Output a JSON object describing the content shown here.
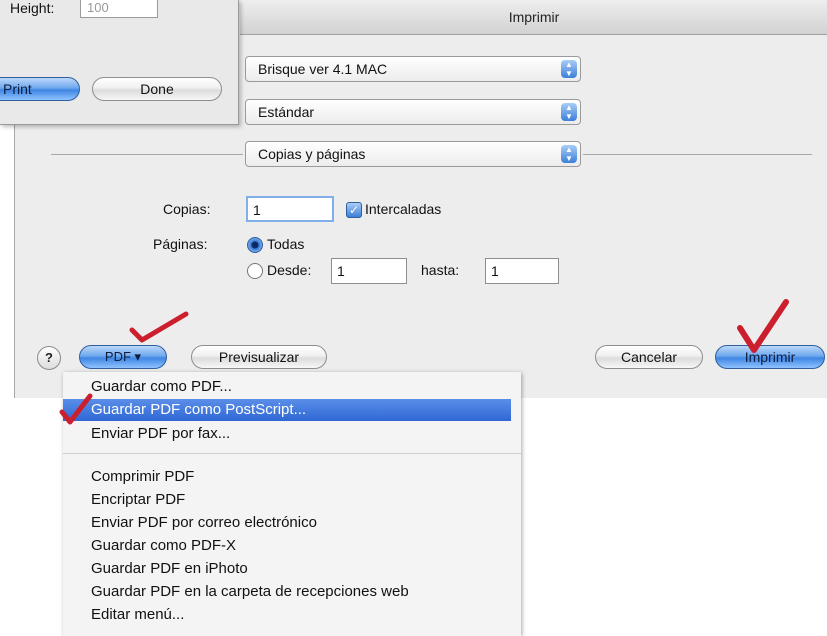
{
  "background_window": {
    "height_label": "Height:",
    "height_value": "100",
    "print_label": "Print",
    "done_label": "Done"
  },
  "dialog": {
    "title": "Imprimir",
    "printer": "Brisque ver 4.1 MAC",
    "preset": "Estándar",
    "pane": "Copias y páginas",
    "copies_label": "Copias:",
    "copies_value": "1",
    "collated_label": "Intercaladas",
    "collated_checked": true,
    "pages_label": "Páginas:",
    "pages_all_label": "Todas",
    "pages_from_label": "Desde:",
    "pages_from_value": "1",
    "pages_to_label": "hasta:",
    "pages_to_value": "1",
    "pages_selected": "all",
    "help_label": "?",
    "pdf_label": "PDF ▾",
    "preview_label": "Previsualizar",
    "cancel_label": "Cancelar",
    "print_label": "Imprimir"
  },
  "pdf_menu": {
    "items": [
      {
        "label": "Guardar como PDF..."
      },
      {
        "label": "Guardar PDF como PostScript...",
        "selected": true
      },
      {
        "label": "Enviar PDF por fax..."
      },
      {
        "label": "Comprimir PDF"
      },
      {
        "label": "Encriptar PDF"
      },
      {
        "label": "Enviar PDF por correo electrónico"
      },
      {
        "label": "Guardar como PDF-X"
      },
      {
        "label": "Guardar PDF en iPhoto"
      },
      {
        "label": "Guardar PDF en la carpeta de recepciones web"
      },
      {
        "label": "Editar menú..."
      }
    ]
  },
  "colors": {
    "annotation_red": "#cc1f2e",
    "selection_blue": "#2f68d4",
    "aqua_blue": "#3f86e3"
  }
}
